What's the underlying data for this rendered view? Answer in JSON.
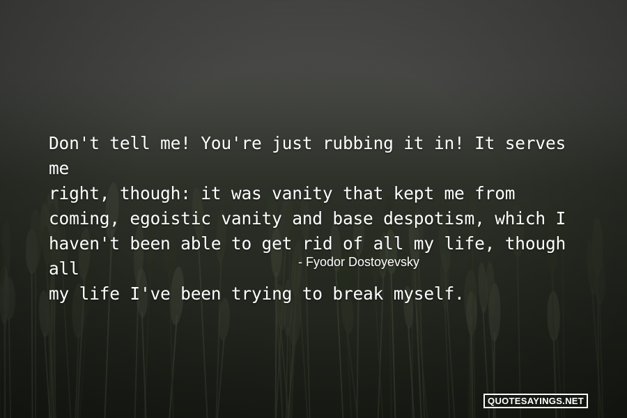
{
  "quote": {
    "text": "Don't tell me! You're just rubbing it in! It serves me\nright, though: it was vanity that kept me from\ncoming, egoistic vanity and base despotism, which I\nhaven't been able to get rid of all my life, though all\nmy life I've been trying to break myself.",
    "author": "- Fyodor Dostoyevsky"
  },
  "watermark": {
    "text": "QUOTESAYINGS.NET"
  },
  "colors": {
    "text": "#ffffff",
    "sky": "#4a4a48",
    "field": "#262a22"
  }
}
